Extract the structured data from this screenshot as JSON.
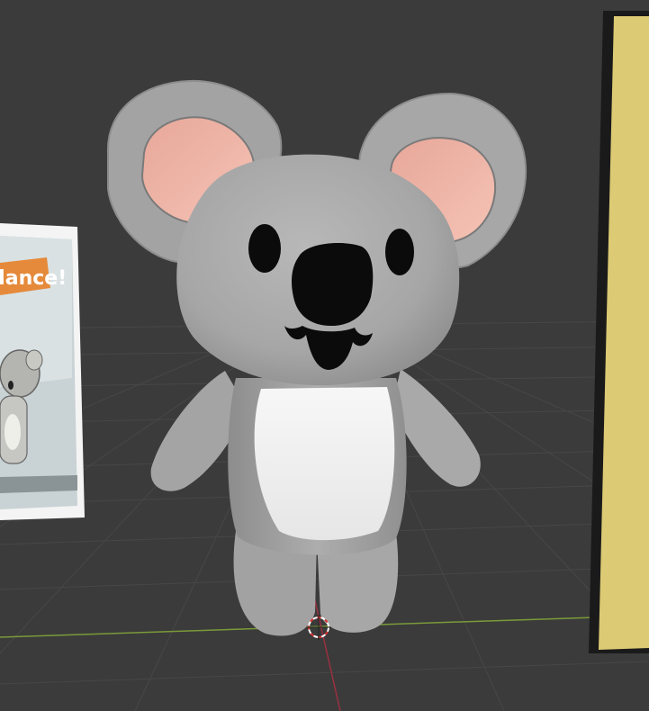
{
  "viewport": {
    "name": "3d-viewport",
    "background": "#3b3b3b",
    "grid_color": "#4a4a4a",
    "x_axis_color": "#7a9a3a",
    "y_axis_color": "#9a3040"
  },
  "objects": [
    {
      "name": "koala-model",
      "kind": "mesh"
    },
    {
      "name": "reference-image-plane",
      "kind": "image"
    },
    {
      "name": "yellow-panel",
      "kind": "plane"
    },
    {
      "name": "3d-cursor",
      "kind": "cursor"
    }
  ],
  "reference_image": {
    "sign_text": "dance!",
    "sign_color": "#e58a3a"
  },
  "colors": {
    "koala_body": "#a9a9a9",
    "koala_belly": "#f2f2f2",
    "koala_ear_inner": "#f0b8ac",
    "koala_nose": "#0b0b0b",
    "panel_yellow": "#dcca74"
  }
}
